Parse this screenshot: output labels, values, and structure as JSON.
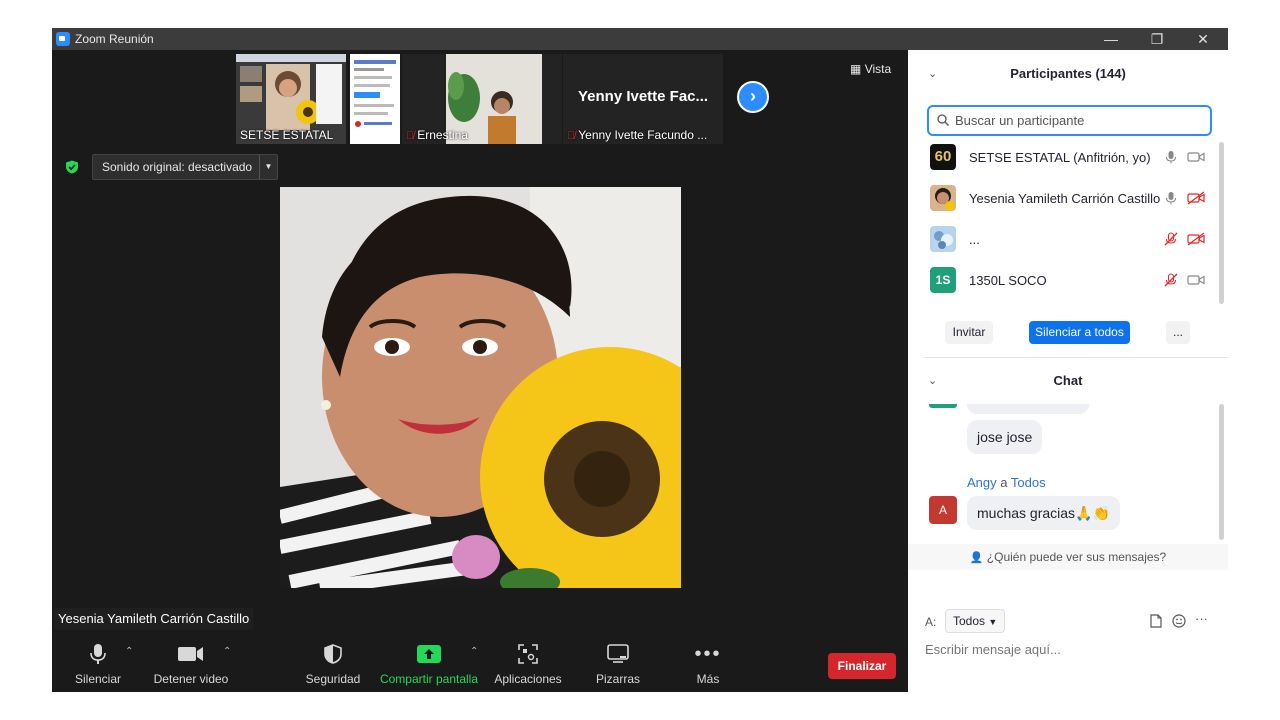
{
  "window": {
    "title": "Zoom Reunión",
    "minimize": "—",
    "restore": "❐",
    "close": "✕"
  },
  "thumbnails": [
    {
      "name": "SETSE ESTATAL",
      "muted": false,
      "show_name_only": false
    },
    {
      "name": "",
      "muted": true,
      "show_name_only": false
    },
    {
      "name": "Ernestina",
      "muted": true,
      "show_name_only": false
    },
    {
      "name": "Yenny Ivette Facundo ...",
      "big_name": "Yenny Ivette Fac...",
      "muted": true,
      "show_name_only": true
    }
  ],
  "view_button": "Vista",
  "sound_original": "Sonido original: desactivado",
  "active_speaker": "Yesenia Yamileth Carrión Castillo",
  "toolbar": {
    "mute": "Silenciar",
    "stop_video": "Detener video",
    "security": "Seguridad",
    "share_screen": "Compartir pantalla",
    "apps": "Aplicaciones",
    "whiteboards": "Pizarras",
    "more": "Más",
    "end": "Finalizar"
  },
  "colors": {
    "accent": "#2d8cff",
    "share_green": "#23d959",
    "end_red": "#d4272c",
    "muted_red": "#e02828"
  },
  "participants": {
    "header": "Participantes (144)",
    "search_placeholder": "Buscar un participante",
    "list": [
      {
        "name": "SETSE ESTATAL (Anfitrión, yo)",
        "avatar": "60",
        "mic_muted": false,
        "video_off": false
      },
      {
        "name": "Yesenia Yamileth Carrión Castillo",
        "avatar": "photo",
        "mic_muted": false,
        "video_off": true
      },
      {
        "name": "...",
        "avatar": "photo",
        "mic_muted": true,
        "video_off": true
      },
      {
        "name": "1350L SOCO",
        "avatar": "1S",
        "mic_muted": true,
        "video_off": false
      }
    ],
    "invite": "Invitar",
    "mute_all": "Silenciar a todos",
    "more": "..."
  },
  "chat": {
    "header": "Chat",
    "messages": [
      {
        "text": "jose jose"
      }
    ],
    "sender": "Angy",
    "sender_avatar": "A",
    "recipient_joiner": "a",
    "recipient": "Todos",
    "last_message": "muchas gracias🙏👏",
    "who_sees": "¿Quién puede ver sus mensajes?",
    "to_label": "A:",
    "to_value": "Todos",
    "input_placeholder": "Escribir mensaje aquí..."
  }
}
